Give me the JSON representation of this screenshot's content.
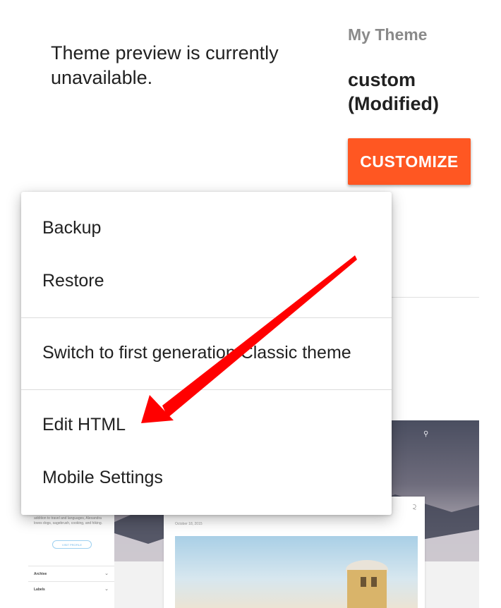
{
  "preview": {
    "message": "Theme preview is currently unavailable."
  },
  "theme": {
    "section_label": "My Theme",
    "name": "custom (Modified)",
    "customize_label": "CUSTOMIZE"
  },
  "menu": {
    "items": [
      {
        "label": "Backup"
      },
      {
        "label": "Restore"
      },
      {
        "label": "Switch to first generation Classic theme"
      },
      {
        "label": "Edit HTML"
      },
      {
        "label": "Mobile Settings"
      }
    ]
  },
  "thumbnail": {
    "date": "October 18, 2015",
    "sidebar_text": "addition to travel and languages, Alexandra loves dogs, sagebrush, cooking, and hiking.",
    "sidebar_button": "VISIT PROFILE",
    "archive_label": "Archive",
    "labels_label": "Labels"
  },
  "colors": {
    "accent": "#ff5722",
    "annotation_arrow": "#ff0000"
  },
  "icons": [
    "search-icon",
    "share-icon",
    "chevron-down-icon",
    "arrow-annotation"
  ]
}
